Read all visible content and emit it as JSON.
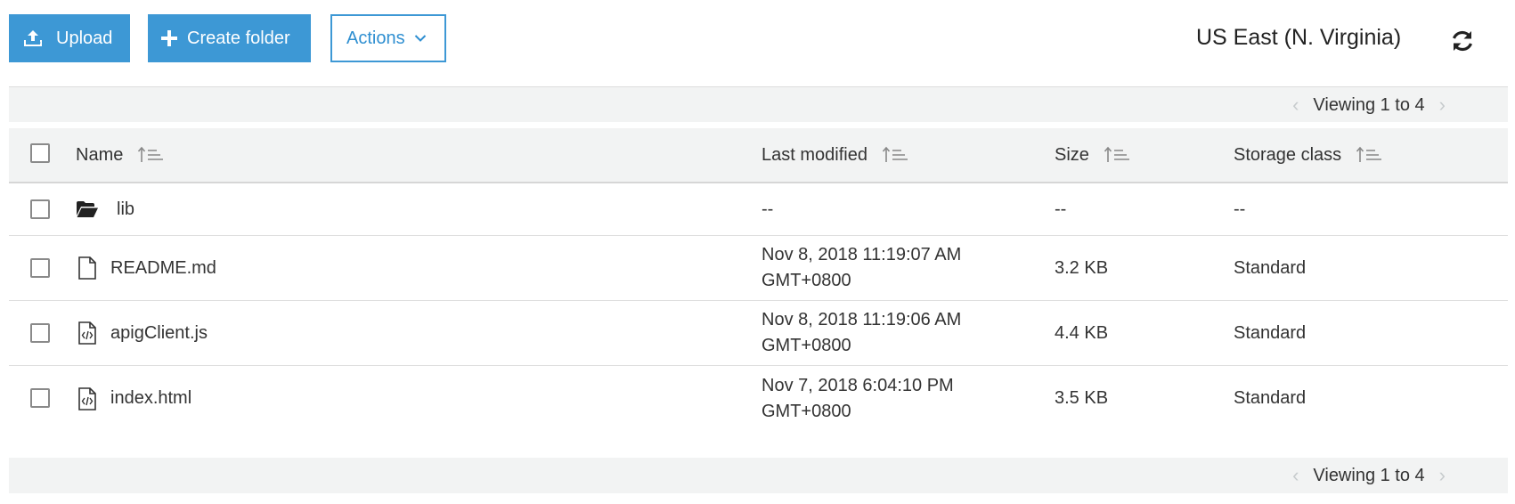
{
  "toolbar": {
    "upload_label": "Upload",
    "create_folder_label": "Create folder",
    "actions_label": "Actions",
    "region": "US East (N. Virginia)",
    "accent_color": "#3d98d5"
  },
  "pager": {
    "text": "Viewing 1 to 4",
    "prev_icon": "chevron-left-icon",
    "next_icon": "chevron-right-icon"
  },
  "table": {
    "columns": [
      "Name",
      "Last modified",
      "Size",
      "Storage class"
    ],
    "rows": [
      {
        "icon": "folder-open-icon",
        "name": "lib",
        "modified_line1": "--",
        "modified_line2": "",
        "size": "--",
        "storage": "--"
      },
      {
        "icon": "file-icon",
        "name": "README.md",
        "modified_line1": "Nov 8, 2018 11:19:07 AM",
        "modified_line2": "GMT+0800",
        "size": "3.2 KB",
        "storage": "Standard"
      },
      {
        "icon": "code-file-icon",
        "name": "apigClient.js",
        "modified_line1": "Nov 8, 2018 11:19:06 AM",
        "modified_line2": "GMT+0800",
        "size": "4.4 KB",
        "storage": "Standard"
      },
      {
        "icon": "code-file-icon",
        "name": "index.html",
        "modified_line1": "Nov 7, 2018 6:04:10 PM",
        "modified_line2": "GMT+0800",
        "size": "3.5 KB",
        "storage": "Standard"
      }
    ]
  }
}
